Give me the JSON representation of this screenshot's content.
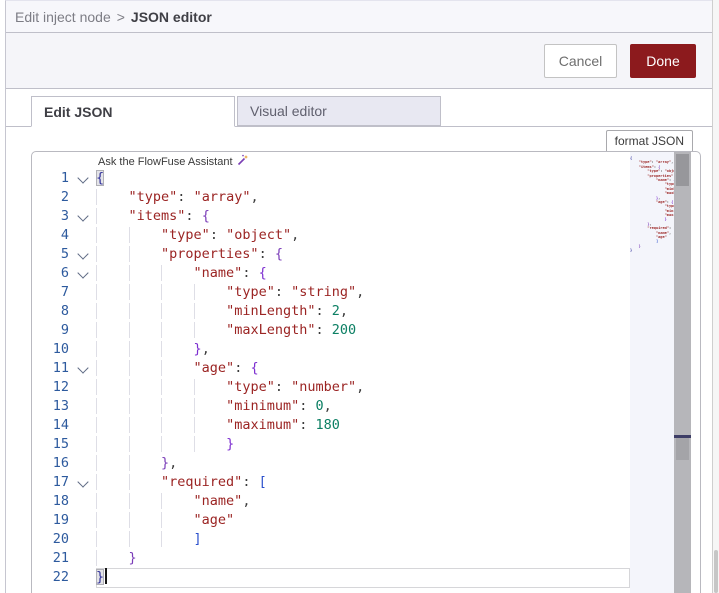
{
  "header": {
    "breadcrumb_parent": "Edit inject node",
    "breadcrumb_separator": ">",
    "breadcrumb_current": "JSON editor"
  },
  "actions": {
    "cancel_label": "Cancel",
    "done_label": "Done"
  },
  "tabs": [
    {
      "label": "Edit JSON",
      "active": true
    },
    {
      "label": "Visual editor",
      "active": false
    }
  ],
  "toolbar": {
    "format_label": "format JSON"
  },
  "assistant": {
    "label": "Ask the FlowFuse Assistant",
    "icon": "magic-wand-icon"
  },
  "palette": {
    "done_button": "#8C1A1D",
    "string_token": "#9b2423",
    "number_token": "#0b7f63",
    "line_number": "#2d5a9e",
    "inactive_tab_bg": "#e8e8f2"
  },
  "editor": {
    "language": "json",
    "line_count": 22,
    "cursor_line": 22,
    "lines": [
      {
        "n": 1,
        "fold": true,
        "tokens": [
          [
            "{",
            "b0 bm"
          ]
        ]
      },
      {
        "n": 2,
        "fold": false,
        "tokens": [
          [
            "    ",
            "ws"
          ],
          [
            "\"type\"",
            "r"
          ],
          [
            ": ",
            "p"
          ],
          [
            "\"array\"",
            "r"
          ],
          [
            ",",
            "p"
          ]
        ]
      },
      {
        "n": 3,
        "fold": true,
        "tokens": [
          [
            "    ",
            "ws"
          ],
          [
            "\"items\"",
            "r"
          ],
          [
            ": ",
            "p"
          ],
          [
            "{",
            "b1"
          ]
        ]
      },
      {
        "n": 4,
        "fold": false,
        "tokens": [
          [
            "        ",
            "ws"
          ],
          [
            "\"type\"",
            "r"
          ],
          [
            ": ",
            "p"
          ],
          [
            "\"object\"",
            "r"
          ],
          [
            ",",
            "p"
          ]
        ]
      },
      {
        "n": 5,
        "fold": true,
        "tokens": [
          [
            "        ",
            "ws"
          ],
          [
            "\"properties\"",
            "r"
          ],
          [
            ": ",
            "p"
          ],
          [
            "{",
            "b2"
          ]
        ]
      },
      {
        "n": 6,
        "fold": true,
        "tokens": [
          [
            "            ",
            "ws"
          ],
          [
            "\"name\"",
            "r"
          ],
          [
            ": ",
            "p"
          ],
          [
            "{",
            "b3"
          ]
        ]
      },
      {
        "n": 7,
        "fold": false,
        "tokens": [
          [
            "                ",
            "ws"
          ],
          [
            "\"type\"",
            "r"
          ],
          [
            ": ",
            "p"
          ],
          [
            "\"string\"",
            "r"
          ],
          [
            ",",
            "p"
          ]
        ]
      },
      {
        "n": 8,
        "fold": false,
        "tokens": [
          [
            "                ",
            "ws"
          ],
          [
            "\"minLength\"",
            "r"
          ],
          [
            ": ",
            "p"
          ],
          [
            "2",
            "n"
          ],
          [
            ",",
            "p"
          ]
        ]
      },
      {
        "n": 9,
        "fold": false,
        "tokens": [
          [
            "                ",
            "ws"
          ],
          [
            "\"maxLength\"",
            "r"
          ],
          [
            ": ",
            "p"
          ],
          [
            "200",
            "n"
          ]
        ]
      },
      {
        "n": 10,
        "fold": false,
        "tokens": [
          [
            "            ",
            "ws"
          ],
          [
            "}",
            "b3"
          ],
          [
            ",",
            "p"
          ]
        ]
      },
      {
        "n": 11,
        "fold": true,
        "tokens": [
          [
            "            ",
            "ws"
          ],
          [
            "\"age\"",
            "r"
          ],
          [
            ": ",
            "p"
          ],
          [
            "{",
            "b3"
          ]
        ]
      },
      {
        "n": 12,
        "fold": false,
        "tokens": [
          [
            "                ",
            "ws"
          ],
          [
            "\"type\"",
            "r"
          ],
          [
            ": ",
            "p"
          ],
          [
            "\"number\"",
            "r"
          ],
          [
            ",",
            "p"
          ]
        ]
      },
      {
        "n": 13,
        "fold": false,
        "tokens": [
          [
            "                ",
            "ws"
          ],
          [
            "\"minimum\"",
            "r"
          ],
          [
            ": ",
            "p"
          ],
          [
            "0",
            "n"
          ],
          [
            ",",
            "p"
          ]
        ]
      },
      {
        "n": 14,
        "fold": false,
        "tokens": [
          [
            "                ",
            "ws"
          ],
          [
            "\"maximum\"",
            "r"
          ],
          [
            ": ",
            "p"
          ],
          [
            "180",
            "n"
          ]
        ]
      },
      {
        "n": 15,
        "fold": false,
        "tokens": [
          [
            "                ",
            "ws"
          ],
          [
            "}",
            "b3"
          ]
        ]
      },
      {
        "n": 16,
        "fold": false,
        "tokens": [
          [
            "        ",
            "ws"
          ],
          [
            "}",
            "b2"
          ],
          [
            ",",
            "p"
          ]
        ]
      },
      {
        "n": 17,
        "fold": true,
        "tokens": [
          [
            "        ",
            "ws"
          ],
          [
            "\"required\"",
            "r"
          ],
          [
            ": ",
            "p"
          ],
          [
            "[",
            "ba"
          ]
        ]
      },
      {
        "n": 18,
        "fold": false,
        "tokens": [
          [
            "            ",
            "ws"
          ],
          [
            "\"name\"",
            "r"
          ],
          [
            ",",
            "p"
          ]
        ]
      },
      {
        "n": 19,
        "fold": false,
        "tokens": [
          [
            "            ",
            "ws"
          ],
          [
            "\"age\"",
            "r"
          ]
        ]
      },
      {
        "n": 20,
        "fold": false,
        "tokens": [
          [
            "            ",
            "ws"
          ],
          [
            "]",
            "ba"
          ]
        ]
      },
      {
        "n": 21,
        "fold": false,
        "tokens": [
          [
            "    ",
            "ws"
          ],
          [
            "}",
            "b1"
          ]
        ]
      },
      {
        "n": 22,
        "fold": false,
        "cursor": true,
        "tokens": [
          [
            "}",
            "b0 bm"
          ]
        ]
      }
    ]
  }
}
